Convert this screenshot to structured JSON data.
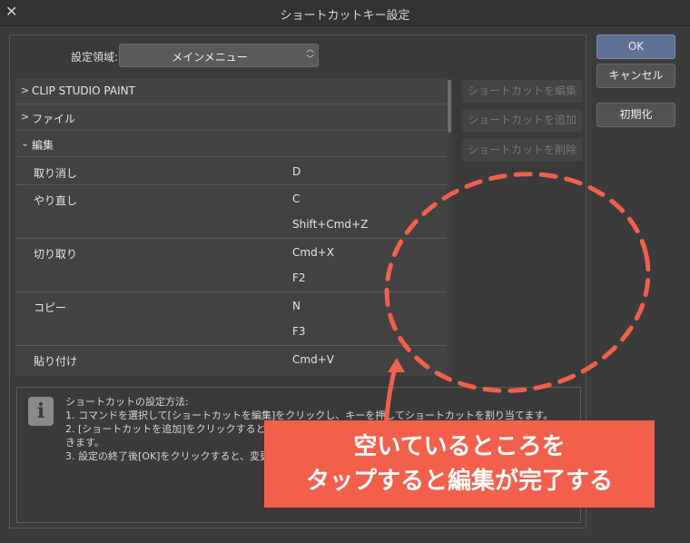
{
  "window": {
    "title": "ショートカットキー設定",
    "close_glyph": "✕"
  },
  "settings_area": {
    "label": "設定領域:",
    "selected": "メインメニュー",
    "options": [
      "メインメニュー"
    ]
  },
  "groups": [
    {
      "label": "CLIP STUDIO PAINT",
      "chevron": ">"
    },
    {
      "label": "ファイル",
      "chevron": ">"
    },
    {
      "label": "編集",
      "chevron": "⌄"
    }
  ],
  "rows": [
    {
      "cmd": "取り消し",
      "key": "D"
    },
    {
      "cmd": "やり直し",
      "key": "C"
    },
    {
      "cmd": "",
      "key": "Shift+Cmd+Z"
    },
    {
      "cmd": "切り取り",
      "key": "Cmd+X"
    },
    {
      "cmd": "",
      "key": "F2"
    },
    {
      "cmd": "コピー",
      "key": "N"
    },
    {
      "cmd": "",
      "key": "F3"
    },
    {
      "cmd": "貼り付け",
      "key": "Cmd+V"
    }
  ],
  "side_buttons": {
    "edit": "ショートカットを編集",
    "add": "ショートカットを追加",
    "delete": "ショートカットを削除"
  },
  "dialog_buttons": {
    "ok": "OK",
    "cancel": "キャンセル",
    "reset": "初期化"
  },
  "info": {
    "icon": "i",
    "lines": [
      "ショートカットの設定方法:",
      "1. コマンドを選択して[ショートカットを編集]をクリックし、キーを押してショートカットを割り当てます。",
      "2. [ショートカットを追加]をクリックすると",
      "きます。",
      "3. 設定の終了後[OK]をクリックすると、変更"
    ]
  },
  "annotation": {
    "line1": "空いているところを",
    "line2": "タップすると編集が完了する",
    "color": "#f2604c"
  },
  "colors": {
    "ok_button": "#5e7094",
    "annotation": "#f2604c"
  }
}
